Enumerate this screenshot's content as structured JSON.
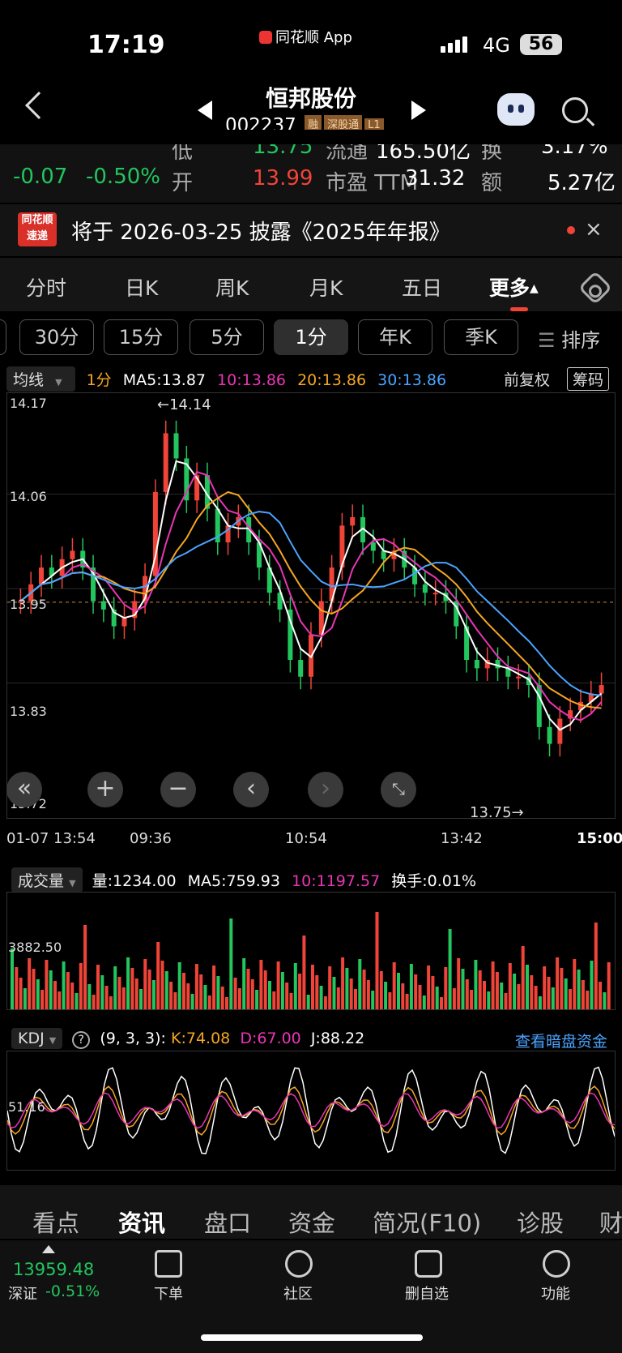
{
  "status_bar": {
    "time": "17:19",
    "app_badge": "同花顺 App",
    "network": "4G",
    "battery": "56"
  },
  "header": {
    "stock_name": "恒邦股份",
    "stock_code": "002237",
    "tags": [
      "融",
      "深股通",
      "L1"
    ]
  },
  "quote": {
    "change": "-0.07",
    "change_pct": "-0.50%",
    "row1": {
      "low_label": "低",
      "low_value": "13.75",
      "float_label": "流通",
      "float_value": "165.50亿",
      "turnover_label": "换",
      "turnover_value": "3.17%"
    },
    "row2": {
      "open_label": "开",
      "open_value": "13.99",
      "pe_label": "市盈 TTM",
      "pe_value": "31.32",
      "amount_label": "额",
      "amount_value": "5.27亿"
    }
  },
  "notice": {
    "logo_top": "同花顺",
    "logo_bottom": "速递",
    "text": "将于 2026-03-25 披露《2025年年报》"
  },
  "kline_tabs": [
    "分时",
    "日K",
    "周K",
    "月K",
    "五日",
    "更多"
  ],
  "period_tabs": [
    "30分",
    "15分",
    "5分",
    "1分",
    "年K",
    "季K"
  ],
  "sort_label": "排序",
  "ma_legend": {
    "type": "均线",
    "period": "1分",
    "ma5": "MA5:13.87",
    "ma10": "10:13.86",
    "ma20": "20:13.86",
    "ma30": "30:13.86",
    "fq": "前复权",
    "chip": "筹码"
  },
  "price_chart": {
    "y_ticks": [
      "14.17",
      "14.06",
      "13.95",
      "13.83",
      "13.72"
    ],
    "x_ticks": [
      "01-07 13:54",
      "09:36",
      "10:54",
      "13:42",
      "15:00"
    ],
    "high_marker": "←14.14",
    "low_marker": "13.75→"
  },
  "volume": {
    "type": "成交量",
    "vol": "量:1234.00",
    "ma5": "MA5:759.93",
    "ma10": "10:1197.57",
    "turnover": "换手:0.01%",
    "y_tick": "3882.50"
  },
  "kdj": {
    "type": "KDJ",
    "params": "(9, 3, 3):",
    "k": "K:74.08",
    "d": "D:67.00",
    "j": "J:88.22",
    "link": "查看暗盘资金",
    "y_tick": "51.16"
  },
  "bottom_tabs": [
    "看点",
    "资讯",
    "盘口",
    "资金",
    "简况(F10)",
    "诊股",
    "财"
  ],
  "dock": {
    "index_value": "13959.48",
    "index_name": "深证",
    "index_change": "-0.51%",
    "buttons": [
      "下单",
      "社区",
      "删自选",
      "功能"
    ]
  },
  "colors": {
    "up": "#f04438",
    "down": "#22c55e",
    "ma5": "#ffffff",
    "ma10": "#e935b5",
    "ma20": "#f5a623",
    "ma30": "#4aa3ff"
  },
  "chart_data": {
    "type": "candlestick",
    "title": "",
    "ylim": [
      13.72,
      14.17
    ],
    "close": [
      13.93,
      13.95,
      13.97,
      13.96,
      13.98,
      13.99,
      13.97,
      13.93,
      13.92,
      13.9,
      13.91,
      13.93,
      13.96,
      14.06,
      14.13,
      14.1,
      14.05,
      14.08,
      14.04,
      14.0,
      14.02,
      14.03,
      14.0,
      13.97,
      13.94,
      13.92,
      13.86,
      13.84,
      13.89,
      13.93,
      13.97,
      14.02,
      14.03,
      14.0,
      13.99,
      13.98,
      13.99,
      13.97,
      13.95,
      13.94,
      13.94,
      13.93,
      13.9,
      13.86,
      13.85,
      13.86,
      13.85,
      13.84,
      13.84,
      13.83,
      13.78,
      13.76,
      13.79,
      13.8,
      13.81,
      13.82,
      13.83
    ]
  }
}
